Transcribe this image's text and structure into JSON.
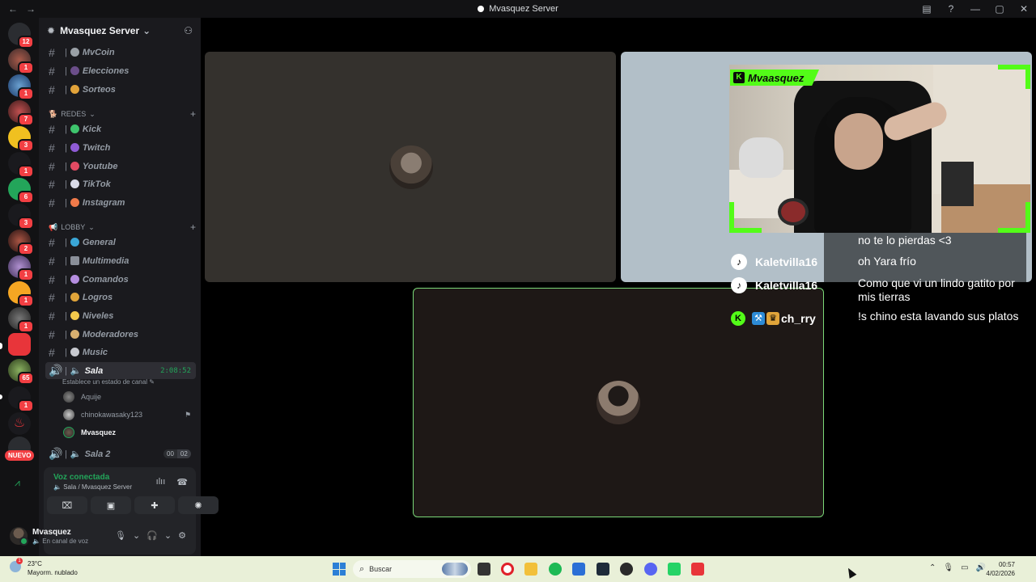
{
  "window": {
    "title": "Mvasquez Server",
    "back_icon": "arrow-left-icon",
    "forward_icon": "arrow-right-icon"
  },
  "rail": {
    "badges": [
      "12",
      "1",
      "1",
      "7",
      "3",
      "1",
      "6",
      "3",
      "2",
      "1",
      "1",
      "1",
      "65",
      "1"
    ],
    "nuevo_label": "NUEVO"
  },
  "server": {
    "name": "Mvasquez Server"
  },
  "channels": {
    "top": [
      {
        "label": "MvCoin",
        "emoji_color": "#9aa0a6"
      },
      {
        "label": "Elecciones",
        "emoji_color": "#6b4e8a"
      },
      {
        "label": "Sorteos",
        "emoji_color": "#e2a33a"
      }
    ],
    "redes_category": "REDES",
    "redes": [
      {
        "label": "Kick",
        "emoji_color": "#3ec46d"
      },
      {
        "label": "Twitch",
        "emoji_color": "#8f5bd6"
      },
      {
        "label": "Youtube",
        "emoji_color": "#e34a63"
      },
      {
        "label": "TikTok",
        "emoji_color": "#d9dbe8"
      },
      {
        "label": "Instagram",
        "emoji_color": "#f07a4a"
      }
    ],
    "lobby_category": "LOBBY",
    "lobby": [
      {
        "label": "General",
        "emoji_color": "#3aa6d6"
      },
      {
        "label": "Multimedia",
        "emoji_color": "#8a8f99"
      },
      {
        "label": "Comandos",
        "emoji_color": "#b58ee0"
      },
      {
        "label": "Logros",
        "emoji_color": "#e0a43a"
      },
      {
        "label": "Niveles",
        "emoji_color": "#f2c94c"
      },
      {
        "label": "Moderadores",
        "emoji_color": "#d9b070"
      },
      {
        "label": "Music",
        "emoji_color": "#c7c9cf"
      }
    ],
    "sala": {
      "label": "Sala",
      "timer": "2:08:52",
      "status_prompt": "Establece un estado de canal"
    },
    "members": [
      "Aquije",
      "chinokawasaky123",
      "Mvasquez"
    ],
    "sala2": {
      "label": "Sala 2",
      "count_a": "00",
      "count_b": "02"
    }
  },
  "voice": {
    "title": "Voz conectada",
    "subtitle": "Sala / Mvasquez Server"
  },
  "user": {
    "name": "Mvasquez",
    "status": "En canal de voz"
  },
  "stream": {
    "streamer_label": "Mvaasquez",
    "chat": [
      {
        "user": "",
        "text": "no te lo pierdas <3"
      },
      {
        "user": "Kaletvilla16",
        "text": "oh Yara frío"
      },
      {
        "user": "Kaletvilla16",
        "text": "Como que vi un lindo gatito por mis tierras"
      },
      {
        "user": "ch_rry",
        "text": "!s chino esta lavando sus platos"
      }
    ]
  },
  "taskbar": {
    "temp": "23°C",
    "weather": "Mayorm. nublado",
    "weather_alert": "1",
    "search_placeholder": "Buscar",
    "time": "00:57",
    "date": "4/02/2026"
  },
  "colors": {
    "accent_green": "#23a55a",
    "kick_green": "#53fc18",
    "speaking_border": "#7bd978",
    "badge_red": "#f23f43"
  }
}
